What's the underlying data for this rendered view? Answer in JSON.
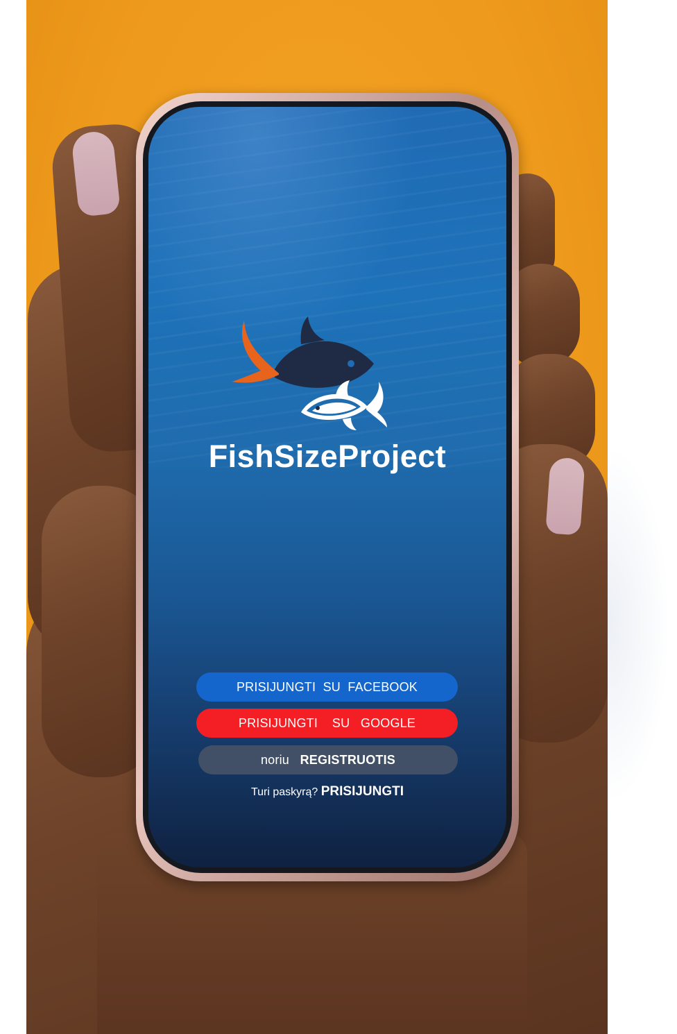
{
  "app": {
    "name": "FishSizeProject"
  },
  "buttons": {
    "facebook": "PRISIJUNGTI  SU  FACEBOOK",
    "google": "PRISIJUNGTI    SU   GOOGLE",
    "register_prefix": "noriu",
    "register_action": "REGISTRUOTIS"
  },
  "login": {
    "question": "Turi paskyrą?",
    "action": "PRISIJUNGTI"
  },
  "colors": {
    "facebook": "#1466cc",
    "google": "#f41f25",
    "register": "#415066",
    "background": "#f0a020",
    "logo_accent": "#e8641c",
    "logo_dark": "#1f2a44"
  },
  "icons": {
    "logo": "two-fish-logo-icon"
  }
}
